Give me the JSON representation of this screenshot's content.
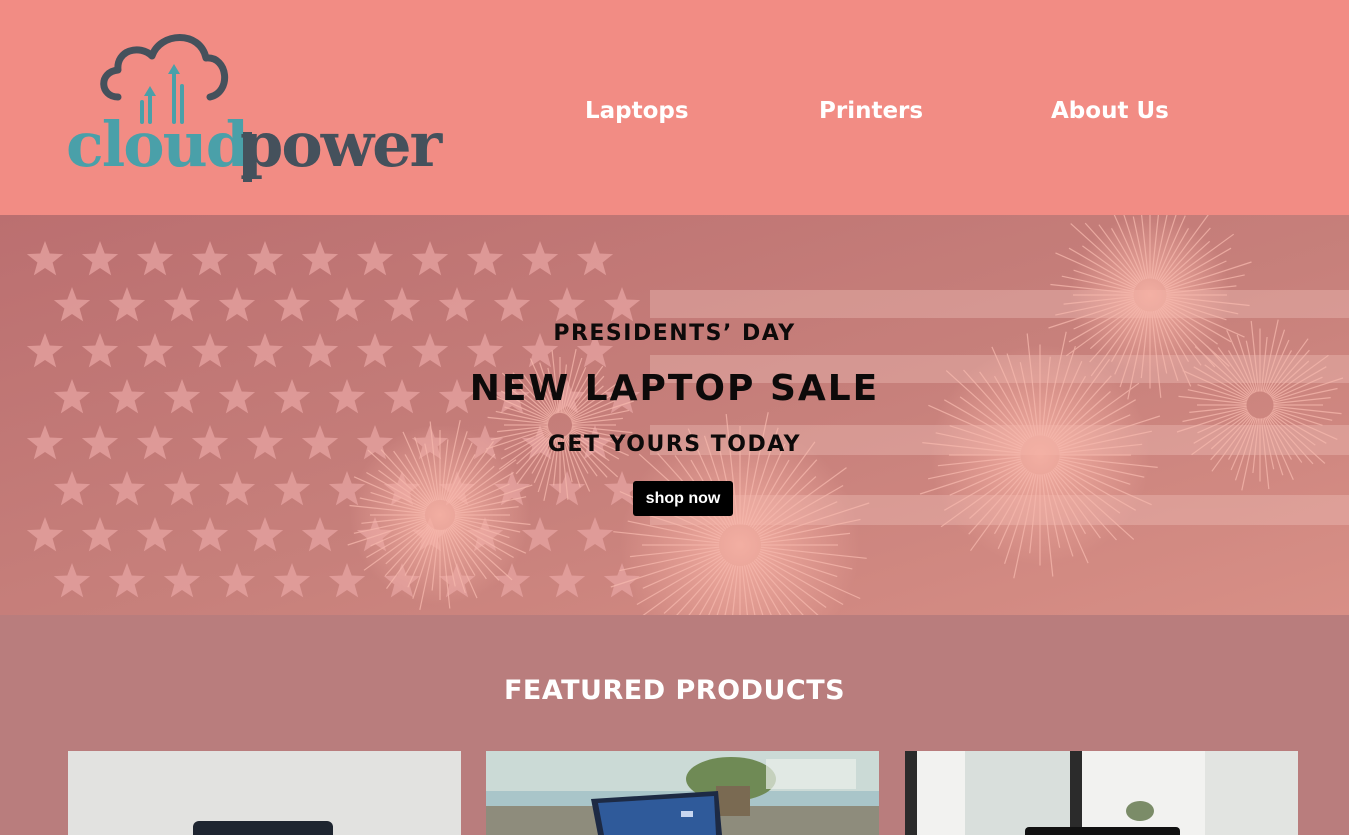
{
  "brand": {
    "name_part1": "cloud",
    "name_part2": "power",
    "color_teal": "#4aa0a9",
    "color_dark": "#45515c"
  },
  "nav": {
    "items": [
      {
        "label": "Laptops"
      },
      {
        "label": "Printers"
      },
      {
        "label": "About Us"
      }
    ]
  },
  "hero": {
    "pretitle": "PRESIDENTS’ DAY",
    "title": "NEW LAPTOP SALE",
    "subtitle": "GET YOURS TODAY",
    "cta_label": "shop now"
  },
  "featured": {
    "title": "FEATURED PRODUCTS",
    "products": [
      {
        "image": "laptop-photo-white-desk"
      },
      {
        "image": "laptop-photo-plant-table"
      },
      {
        "image": "laptop-photo-window-office"
      }
    ]
  },
  "colors": {
    "header_bg": "#f28c84",
    "hero_tint": "#c77a76",
    "featured_bg": "#b97d7d",
    "button_bg": "#000000",
    "nav_text": "#ffffff"
  }
}
